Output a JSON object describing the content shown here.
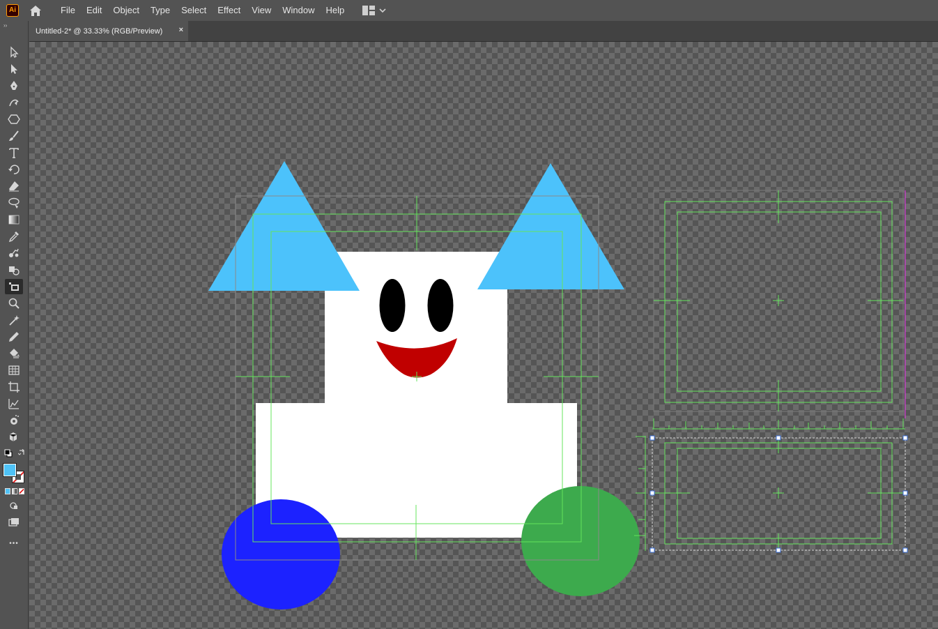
{
  "app": {
    "logo_text": "Ai"
  },
  "menu": {
    "items": [
      "File",
      "Edit",
      "Object",
      "Type",
      "Select",
      "Effect",
      "View",
      "Window",
      "Help"
    ]
  },
  "document": {
    "tab_title": "Untitled-2* @ 33.33% (RGB/Preview)",
    "close_glyph": "×"
  },
  "toolbar": {
    "collapse_glyph": "››",
    "more_glyph": "•••",
    "tools": [
      {
        "name": "selection-tool",
        "icon": "arrow-outline-icon"
      },
      {
        "name": "direct-selection-tool",
        "icon": "arrow-filled-icon"
      },
      {
        "name": "pen-tool",
        "icon": "pen-icon"
      },
      {
        "name": "curvature-tool",
        "icon": "curvature-icon"
      },
      {
        "name": "shape-tool",
        "icon": "hexagon-icon"
      },
      {
        "name": "paintbrush-tool",
        "icon": "brush-icon"
      },
      {
        "name": "type-tool",
        "icon": "type-icon"
      },
      {
        "name": "rotate-tool",
        "icon": "rotate-icon"
      },
      {
        "name": "eraser-tool",
        "icon": "eraser-icon"
      },
      {
        "name": "lasso-tool",
        "icon": "lasso-icon"
      },
      {
        "name": "gradient-tool",
        "icon": "gradient-icon"
      },
      {
        "name": "eyedropper-tool",
        "icon": "eyedropper-icon"
      },
      {
        "name": "blend-tool",
        "icon": "blend-icon"
      },
      {
        "name": "shape-builder-tool",
        "icon": "shape-builder-icon"
      },
      {
        "name": "perspective-tool",
        "icon": "perspective-icon"
      },
      {
        "name": "zoom-tool",
        "icon": "zoom-icon"
      },
      {
        "name": "magic-wand-tool",
        "icon": "wand-icon"
      },
      {
        "name": "pencil-tool",
        "icon": "pencil-icon"
      },
      {
        "name": "live-paint-tool",
        "icon": "paint-bucket-icon"
      },
      {
        "name": "mesh-tool",
        "icon": "grid-icon"
      },
      {
        "name": "artboard-tool",
        "icon": "artboard-icon"
      },
      {
        "name": "graph-tool",
        "icon": "graph-icon"
      },
      {
        "name": "symbol-sprayer-tool",
        "icon": "sprayer-icon"
      },
      {
        "name": "3d-tool",
        "icon": "cube-icon"
      }
    ],
    "active_tool": "perspective-tool",
    "fill_color": "#4fc3f7",
    "stroke": "none"
  },
  "artwork": {
    "colors": {
      "body": "#ffffff",
      "ears": "#4cc2fb",
      "eyes": "#000000",
      "mouth": "#c00000",
      "wheel_left": "#1c22ff",
      "wheel_right": "#3daa4d",
      "guides": "#64e45c",
      "selection": "#ffffff",
      "magenta_guide": "#d23bd2"
    }
  }
}
